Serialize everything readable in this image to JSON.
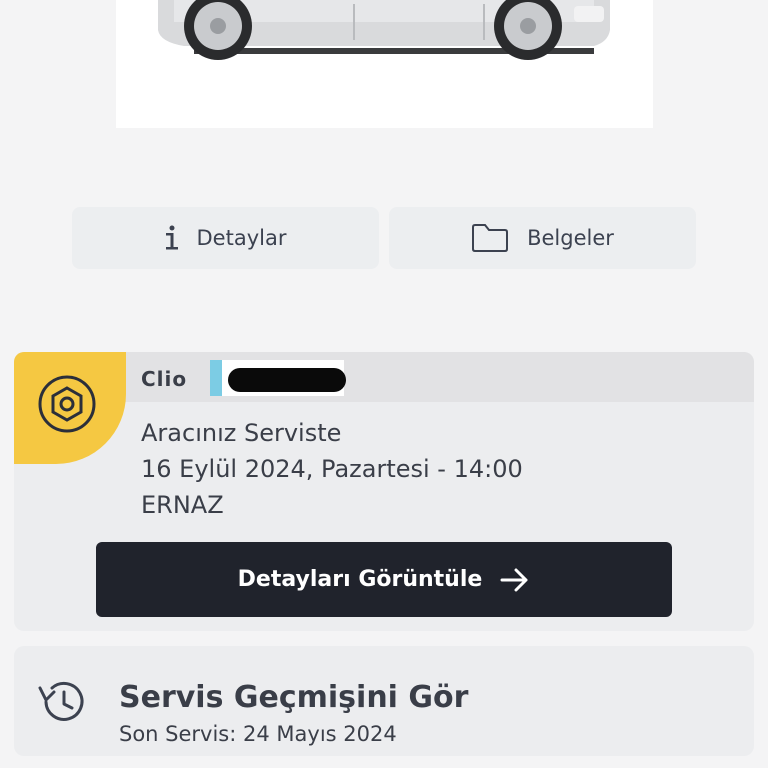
{
  "actions": {
    "details_label": "Detaylar",
    "documents_label": "Belgeler",
    "details_icon": "info-icon",
    "documents_icon": "folder-icon"
  },
  "service_card": {
    "model": "Clio",
    "status": "Aracınız Serviste",
    "date": "16 Eylül 2024, Pazartesi - 14:00",
    "dealer": "ERNAZ",
    "button_label": "Detayları Görüntüle",
    "accent_color": "#f5c842",
    "plate_stripe_color": "#7ccce4",
    "icon": "gear-icon",
    "button_icon": "arrow-right-icon"
  },
  "history": {
    "title": "Servis Geçmişini Gör",
    "subtitle": "Son Servis: 24 Mayıs 2024",
    "icon": "history-icon"
  }
}
